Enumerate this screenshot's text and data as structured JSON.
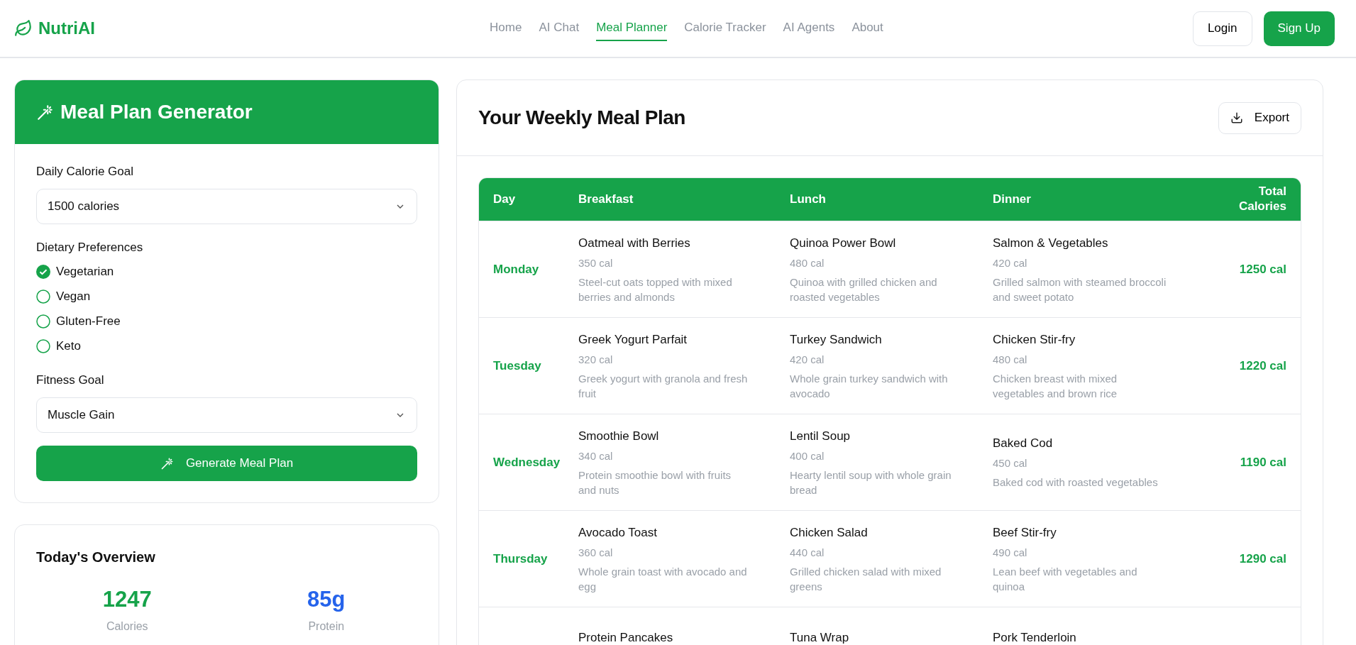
{
  "brand": "NutriAI",
  "nav": [
    {
      "label": "Home",
      "selected": false
    },
    {
      "label": "AI Chat",
      "selected": false
    },
    {
      "label": "Meal Planner",
      "selected": true
    },
    {
      "label": "Calorie Tracker",
      "selected": false
    },
    {
      "label": "AI Agents",
      "selected": false
    },
    {
      "label": "About",
      "selected": false
    }
  ],
  "auth": {
    "login": "Login",
    "signup": "Sign Up"
  },
  "generator": {
    "title": "Meal Plan Generator",
    "calorie_label": "Daily Calorie Goal",
    "calorie_value": "1500 calories",
    "prefs_label": "Dietary Preferences",
    "prefs": [
      {
        "label": "Vegetarian",
        "checked": true
      },
      {
        "label": "Vegan",
        "checked": false
      },
      {
        "label": "Gluten-Free",
        "checked": false
      },
      {
        "label": "Keto",
        "checked": false
      }
    ],
    "fitness_label": "Fitness Goal",
    "fitness_value": "Muscle Gain",
    "button": "Generate Meal Plan"
  },
  "overview": {
    "title": "Today's Overview",
    "stats": [
      {
        "value": "1247",
        "label": "Calories",
        "color": "#16a34a"
      },
      {
        "value": "85g",
        "label": "Protein",
        "color": "#2563eb"
      }
    ]
  },
  "plan": {
    "title": "Your Weekly Meal Plan",
    "export": "Export",
    "columns": [
      "Day",
      "Breakfast",
      "Lunch",
      "Dinner",
      "Total Calories"
    ],
    "rows": [
      {
        "day": "Monday",
        "total": "1250 cal",
        "meals": [
          {
            "name": "Oatmeal with Berries",
            "cal": "350 cal",
            "desc": "Steel-cut oats topped with mixed berries and almonds"
          },
          {
            "name": "Quinoa Power Bowl",
            "cal": "480 cal",
            "desc": "Quinoa with grilled chicken and roasted vegetables"
          },
          {
            "name": "Salmon & Vegetables",
            "cal": "420 cal",
            "desc": "Grilled salmon with steamed broccoli and sweet potato"
          }
        ]
      },
      {
        "day": "Tuesday",
        "total": "1220 cal",
        "meals": [
          {
            "name": "Greek Yogurt Parfait",
            "cal": "320 cal",
            "desc": "Greek yogurt with granola and fresh fruit"
          },
          {
            "name": "Turkey Sandwich",
            "cal": "420 cal",
            "desc": "Whole grain turkey sandwich with avocado"
          },
          {
            "name": "Chicken Stir-fry",
            "cal": "480 cal",
            "desc": "Chicken breast with mixed vegetables and brown rice"
          }
        ]
      },
      {
        "day": "Wednesday",
        "total": "1190 cal",
        "meals": [
          {
            "name": "Smoothie Bowl",
            "cal": "340 cal",
            "desc": "Protein smoothie bowl with fruits and nuts"
          },
          {
            "name": "Lentil Soup",
            "cal": "400 cal",
            "desc": "Hearty lentil soup with whole grain bread"
          },
          {
            "name": "Baked Cod",
            "cal": "450 cal",
            "desc": "Baked cod with roasted vegetables"
          }
        ]
      },
      {
        "day": "Thursday",
        "total": "1290 cal",
        "meals": [
          {
            "name": "Avocado Toast",
            "cal": "360 cal",
            "desc": "Whole grain toast with avocado and egg"
          },
          {
            "name": "Chicken Salad",
            "cal": "440 cal",
            "desc": "Grilled chicken salad with mixed greens"
          },
          {
            "name": "Beef Stir-fry",
            "cal": "490 cal",
            "desc": "Lean beef with vegetables and quinoa"
          }
        ]
      },
      {
        "meals": [
          {
            "name": "Protein Pancakes"
          },
          {
            "name": "Tuna Wrap"
          },
          {
            "name": "Pork Tenderloin"
          }
        ]
      }
    ]
  }
}
